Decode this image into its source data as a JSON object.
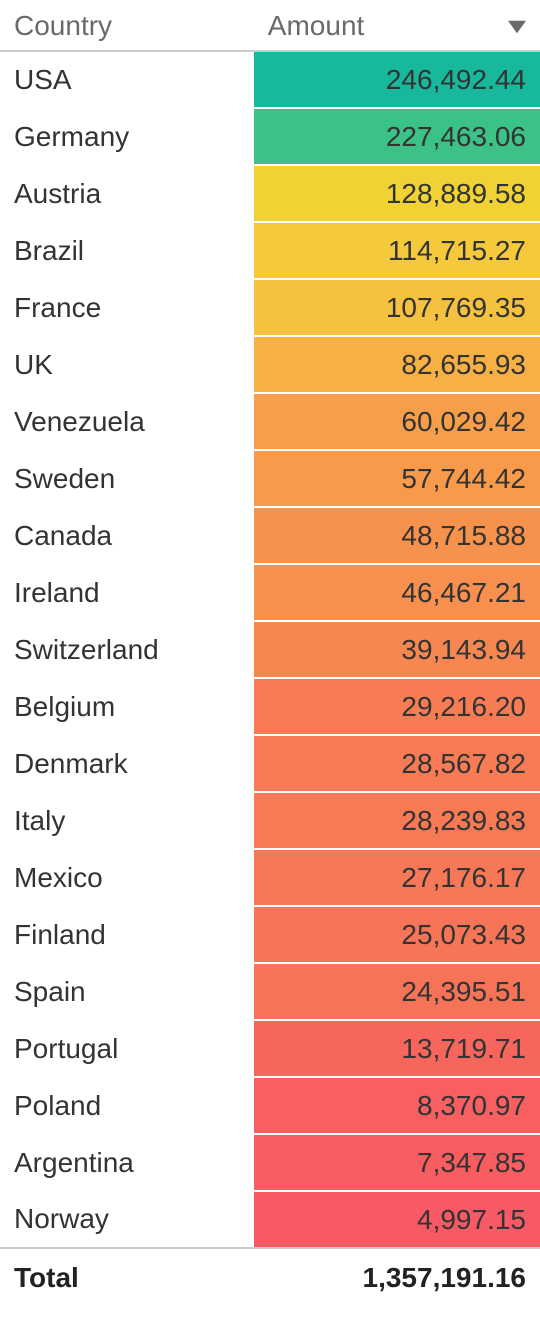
{
  "headers": {
    "country": "Country",
    "amount": "Amount"
  },
  "rows": [
    {
      "country": "USA",
      "amount": "246,492.44",
      "color": "#17b89c"
    },
    {
      "country": "Germany",
      "amount": "227,463.06",
      "color": "#3cc287"
    },
    {
      "country": "Austria",
      "amount": "128,889.58",
      "color": "#f0d235"
    },
    {
      "country": "Brazil",
      "amount": "114,715.27",
      "color": "#f4c93b"
    },
    {
      "country": "France",
      "amount": "107,769.35",
      "color": "#f5c23f"
    },
    {
      "country": "UK",
      "amount": "82,655.93",
      "color": "#f7b044"
    },
    {
      "country": "Venezuela",
      "amount": "60,029.42",
      "color": "#f79e4a"
    },
    {
      "country": "Sweden",
      "amount": "57,744.42",
      "color": "#f79b4b"
    },
    {
      "country": "Canada",
      "amount": "48,715.88",
      "color": "#f7924d"
    },
    {
      "country": "Ireland",
      "amount": "46,467.21",
      "color": "#f78f4f"
    },
    {
      "country": "Switzerland",
      "amount": "39,143.94",
      "color": "#f78750"
    },
    {
      "country": "Belgium",
      "amount": "29,216.20",
      "color": "#f77c54"
    },
    {
      "country": "Denmark",
      "amount": "28,567.82",
      "color": "#f77b55"
    },
    {
      "country": "Italy",
      "amount": "28,239.83",
      "color": "#f77a55"
    },
    {
      "country": "Mexico",
      "amount": "27,176.17",
      "color": "#f77856"
    },
    {
      "country": "Finland",
      "amount": "25,073.43",
      "color": "#f77557"
    },
    {
      "country": "Spain",
      "amount": "24,395.51",
      "color": "#f77358"
    },
    {
      "country": "Portugal",
      "amount": "13,719.71",
      "color": "#f7665d"
    },
    {
      "country": "Poland",
      "amount": "8,370.97",
      "color": "#f75f60"
    },
    {
      "country": "Argentina",
      "amount": "7,347.85",
      "color": "#f75d61"
    },
    {
      "country": "Norway",
      "amount": "4,997.15",
      "color": "#f75a64"
    }
  ],
  "total": {
    "label": "Total",
    "value": "1,357,191.16"
  },
  "chart_data": {
    "type": "table",
    "title": "",
    "columns": [
      "Country",
      "Amount"
    ],
    "categories": [
      "USA",
      "Germany",
      "Austria",
      "Brazil",
      "France",
      "UK",
      "Venezuela",
      "Sweden",
      "Canada",
      "Ireland",
      "Switzerland",
      "Belgium",
      "Denmark",
      "Italy",
      "Mexico",
      "Finland",
      "Spain",
      "Portugal",
      "Poland",
      "Argentina",
      "Norway"
    ],
    "values": [
      246492.44,
      227463.06,
      128889.58,
      114715.27,
      107769.35,
      82655.93,
      60029.42,
      57744.42,
      48715.88,
      46467.21,
      39143.94,
      29216.2,
      28567.82,
      28239.83,
      27176.17,
      25073.43,
      24395.51,
      13719.71,
      8370.97,
      7347.85,
      4997.15
    ],
    "total": 1357191.16,
    "sort": {
      "column": "Amount",
      "direction": "desc"
    },
    "color_scale": {
      "low": "#f75a64",
      "mid": "#f7b044",
      "high": "#17b89c",
      "applied_to": "Amount"
    }
  }
}
